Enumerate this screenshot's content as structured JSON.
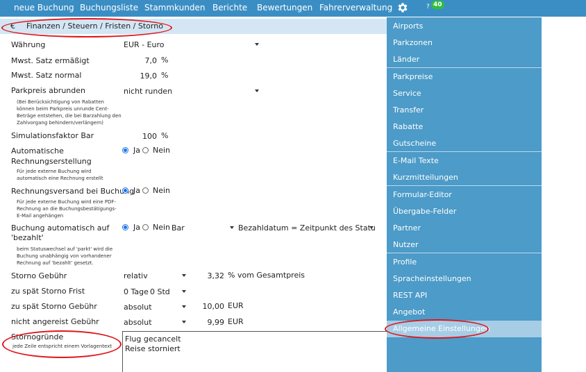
{
  "nav": {
    "items": [
      "neue Buchung",
      "Buchungsliste",
      "Stammkunden",
      "Berichte",
      "Bewertungen",
      "Fahrerverwaltung"
    ],
    "help": "?",
    "badge": "40"
  },
  "section": {
    "icon": "€",
    "title": "Finanzen / Steuern / Fristen / Storno"
  },
  "form": {
    "waehrung": {
      "label": "Währung",
      "value": "EUR - Euro"
    },
    "mwst_erm": {
      "label": "Mwst. Satz ermäßigt",
      "value": "7,0",
      "unit": "%"
    },
    "mwst_norm": {
      "label": "Mwst. Satz normal",
      "value": "19,0",
      "unit": "%"
    },
    "parkpreis": {
      "label": "Parkpreis abrunden",
      "value": "nicht runden",
      "hint": [
        "(Bei Berücksichtigung von Rabatten",
        "können beim Parkpreis unrunde Cent-",
        "Beträge entstehen, die bei Barzahlung den",
        "Zahlvorgang behindern/verlängern)"
      ]
    },
    "simulation": {
      "label": "Simulationsfaktor Bar",
      "value": "100",
      "unit": "%"
    },
    "auto_rechnung": {
      "label": [
        "Automatische",
        "Rechnungserstellung"
      ],
      "hint": [
        "Für jede externe Buchung wird",
        "automatisch eine Rechnung erstellt"
      ],
      "yes": "Ja",
      "no": "Nein"
    },
    "rechnungsversand": {
      "label": "Rechnungsversand bei Buchung",
      "hint": [
        "Für jede externe Buchung wird eine PDF-",
        "Rechnung an die Buchungsbestätigungs-",
        "E-Mail angehängen"
      ],
      "yes": "Ja",
      "no": "Nein"
    },
    "bezahlt": {
      "label": [
        "Buchung automatisch auf",
        "'bezahlt'"
      ],
      "hint": [
        "beim Statuswechsel auf 'parkt' wird die",
        "Buchung unabhängig von vorhandener",
        "Rechnung auf 'bezahlt' gesetzt."
      ],
      "yes": "Ja",
      "no": "Nein",
      "zahlart": "Bar",
      "datum": "Bezahldatum = Zeitpunkt des Statusw"
    },
    "storno_gebuehr": {
      "label": "Storno Gebühr",
      "type": "relativ",
      "value": "3,32",
      "unit": "% vom Gesamtpreis"
    },
    "storno_frist": {
      "label": "zu spät Storno Frist",
      "tage": "0 Tage",
      "std": "0 Std"
    },
    "storno_spaet": {
      "label": "zu spät Storno Gebühr",
      "type": "absolut",
      "value": "10,00",
      "unit": "EUR"
    },
    "nicht_angereist": {
      "label": "nicht angereist Gebühr",
      "type": "absolut",
      "value": "9,99",
      "unit": "EUR"
    },
    "stornogruende": {
      "label": "Stornogründe",
      "hint": "jede Zeile entspricht einem Vorlagentext",
      "lines": [
        "Flug gecancelt",
        "Reise storniert"
      ]
    }
  },
  "sidebar": {
    "items": [
      "Airports",
      "Parkzonen",
      "Länder",
      "Parkpreise",
      "Service",
      "Transfer",
      "Rabatte",
      "Gutscheine",
      "E-Mail Texte",
      "Kurzmitteilungen",
      "Formular-Editor",
      "Übergabe-Felder",
      "Partner",
      "Nutzer",
      "Profile",
      "Spracheinstellungen",
      "REST API",
      "Angebot",
      "Allgemeine Einstellungen"
    ],
    "active": "Allgemeine Einstellungen"
  },
  "colors": {
    "nav": "#3b8ec4",
    "sidebar": "#4c9bc8",
    "active": "#a7cde6",
    "section": "#d4e6f4",
    "highlight": "#e0141a",
    "badge": "#2fbf3a"
  }
}
